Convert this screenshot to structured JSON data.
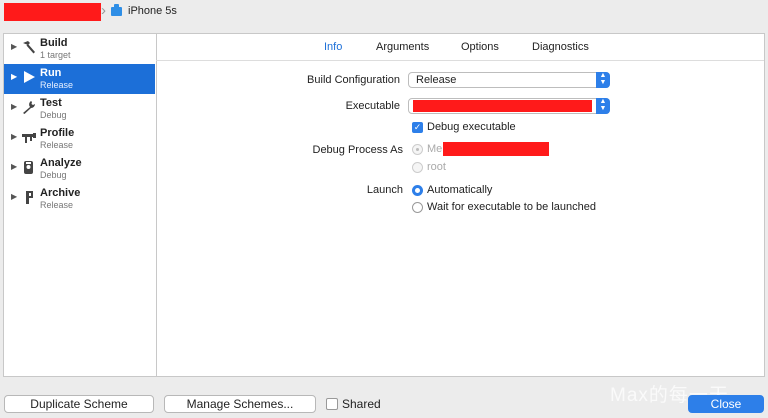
{
  "toolbar": {
    "device": "iPhone 5s"
  },
  "sidebar": {
    "items": [
      {
        "title": "Build",
        "subtitle": "1 target",
        "icon": "hammer-icon"
      },
      {
        "title": "Run",
        "subtitle": "Release",
        "icon": "play-icon"
      },
      {
        "title": "Test",
        "subtitle": "Debug",
        "icon": "wrench-icon"
      },
      {
        "title": "Profile",
        "subtitle": "Release",
        "icon": "gauge-icon"
      },
      {
        "title": "Analyze",
        "subtitle": "Debug",
        "icon": "analyze-icon"
      },
      {
        "title": "Archive",
        "subtitle": "Release",
        "icon": "archive-icon"
      }
    ],
    "selected": "Run"
  },
  "tabs": [
    "Info",
    "Arguments",
    "Options",
    "Diagnostics"
  ],
  "active_tab": "Info",
  "form": {
    "build_configuration_label": "Build Configuration",
    "build_configuration_value": "Release",
    "executable_label": "Executable",
    "debug_executable_label": "Debug executable",
    "debug_process_label": "Debug Process As",
    "debug_process_me": "Me",
    "debug_process_root": "root",
    "launch_label": "Launch",
    "launch_auto": "Automatically",
    "launch_wait": "Wait for executable to be launched"
  },
  "footer": {
    "duplicate": "Duplicate Scheme",
    "manage": "Manage Schemes...",
    "shared": "Shared",
    "close": "Close"
  },
  "watermark": "Max的每一天",
  "colors": {
    "accent": "#2d7fe9",
    "selection": "#1c6fd8",
    "redaction": "#ff1a1a"
  }
}
